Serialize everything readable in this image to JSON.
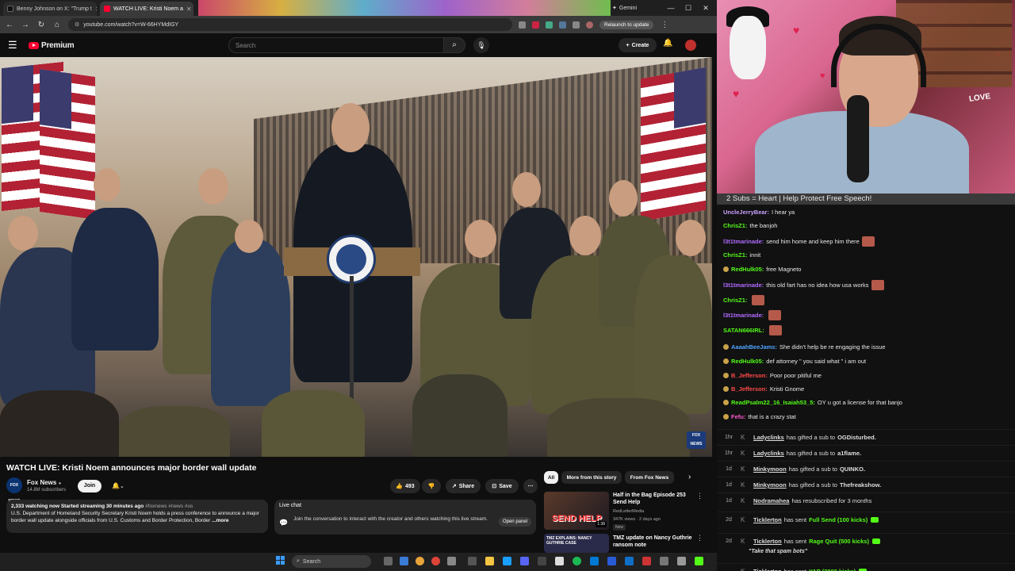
{
  "browser": {
    "tabs": [
      {
        "label": "Benny Johnson on X: \"Trump t",
        "fav": "#111111"
      },
      {
        "label": "WATCH LIVE: Kristi Noem a",
        "fav": "#ff0033"
      }
    ],
    "gemini_label": "Gemini",
    "url": "youtube.com/watch?v=W-66HYMdIGY",
    "relaunch_label": "Relaunch to update"
  },
  "youtube": {
    "logo_text": "Premium",
    "search_placeholder": "Search",
    "create_label": "Create",
    "video": {
      "title": "WATCH LIVE: Kristi Noem announces major border wall update",
      "seal_text": "DEPARTMENT OF HOMELAND SECURITY",
      "watermark": "FOX NEWS"
    },
    "channel": {
      "name": "Fox News",
      "subs": "14.8M subscribers",
      "avatar_text": "FOX NEWS",
      "join_label": "Join"
    },
    "actions": {
      "likes": "493",
      "share_label": "Share",
      "save_label": "Save"
    },
    "description": {
      "meta": "2,333 watching now  Started streaming 30 minutes ago",
      "tags": "#foxnews #news #us",
      "text": "U.S. Department of Homeland Security Secretary Kristi Noem holds a press conference to announce a major border wall update alongside officials from U.S. Customs and Border Protection, Border",
      "more_label": "...more"
    },
    "live_chat": {
      "title": "Live chat",
      "text": "Join the conversation to interact with the creator and others watching this live stream.",
      "open_label": "Open panel"
    },
    "chips": [
      "All",
      "More from this story",
      "From Fox News"
    ],
    "recs": [
      {
        "title": "Half in the Bag Episode 253 Send Help",
        "channel": "RedLetterMedia",
        "meta": "347K views · 2 days ago",
        "badge": "New",
        "duration": "1:38",
        "thumb_text": "SEND HELP"
      },
      {
        "title": "TMZ update on Nancy Guthrie ransom note",
        "thumb_text": "TMZ EXPLAINS: NANCY GUTHRIE CASE"
      }
    ]
  },
  "stream": {
    "banner": "2 Subs = Heart | Help Protect Free Speech!",
    "love_sign": "LOVE",
    "chat": [
      {
        "user": "UncleJerryBear:",
        "text": "I hear ya",
        "color": "#c9a0ff"
      },
      {
        "user": "ChrisZ1:",
        "text": "the banjoh",
        "color": "#53fc18"
      },
      {
        "user": "l3t1tmarinade:",
        "text": "send him home and keep him there",
        "color": "#b06bff",
        "emote": true
      },
      {
        "user": "ChrisZ1:",
        "text": "innit",
        "color": "#53fc18"
      },
      {
        "user": "RedHulk05:",
        "text": "free Magneto",
        "color": "#53fc18",
        "badge": true
      },
      {
        "user": "l3t1tmarinade:",
        "text": "this old fart has no idea how usa works",
        "color": "#b06bff",
        "emote": true
      },
      {
        "user": "ChrisZ1:",
        "text": "",
        "color": "#53fc18",
        "emote": true
      },
      {
        "user": "l3t1tmarinade:",
        "text": "",
        "color": "#b06bff",
        "emote": true
      },
      {
        "user": "SATAN666IRL:",
        "text": "",
        "color": "#53fc18",
        "emote": true
      },
      {
        "user": "AaaahBeeJams:",
        "text": "She didn't help be re engaging the issue",
        "color": "#4fa3ff",
        "badge": true
      },
      {
        "user": "RedHulk05:",
        "text": "def attorney \" you said what \" i am out",
        "color": "#53fc18",
        "badge": true
      },
      {
        "user": "B_Jefferson:",
        "text": "Poor poor pitiful me",
        "color": "#ff4a4a",
        "badge": true
      },
      {
        "user": "B_Jefferson:",
        "text": "Kristi Gnome",
        "color": "#ff4a4a",
        "badge": true
      },
      {
        "user": "ReadPsalm22_16_Isaiah53_5:",
        "text": "OY u got a license for that banjo",
        "color": "#53fc18",
        "badge": true
      },
      {
        "user": "Fefu:",
        "text": "that is a crazy stat",
        "color": "#ff5ad0",
        "badge": true
      }
    ],
    "events": [
      {
        "time": "1hr",
        "user": "Ladyclinks",
        "action": "has gifted a sub to",
        "target": "OGDisturbed."
      },
      {
        "time": "1hr",
        "user": "Ladyclinks",
        "action": "has gifted a sub to",
        "target": "a1flame."
      },
      {
        "time": "1d",
        "user": "Minkymoon",
        "action": "has gifted a sub to",
        "target": "QUINKO."
      },
      {
        "time": "1d",
        "user": "Minkymoon",
        "action": "has gifted a sub to",
        "target": "Thefreakshow."
      },
      {
        "time": "1d",
        "user": "Nodramahea",
        "action": "has resubscribed for 3 months",
        "target": ""
      },
      {
        "time": "2d",
        "user": "Ticklerton",
        "action": "has sent",
        "target": "",
        "kick": "Full Send (100 kicks)"
      },
      {
        "time": "2d",
        "user": "Ticklerton",
        "action": "has sent",
        "target": "",
        "kick": "Rage Quit (500 kicks)"
      },
      {
        "time": "",
        "user": "Ticklerton",
        "action": "has sent",
        "target": "",
        "kick": "YAP (2000 kicks)"
      }
    ],
    "spam_quote": "\"Take that spam bots\""
  },
  "taskbar": {
    "search_label": "Search"
  }
}
